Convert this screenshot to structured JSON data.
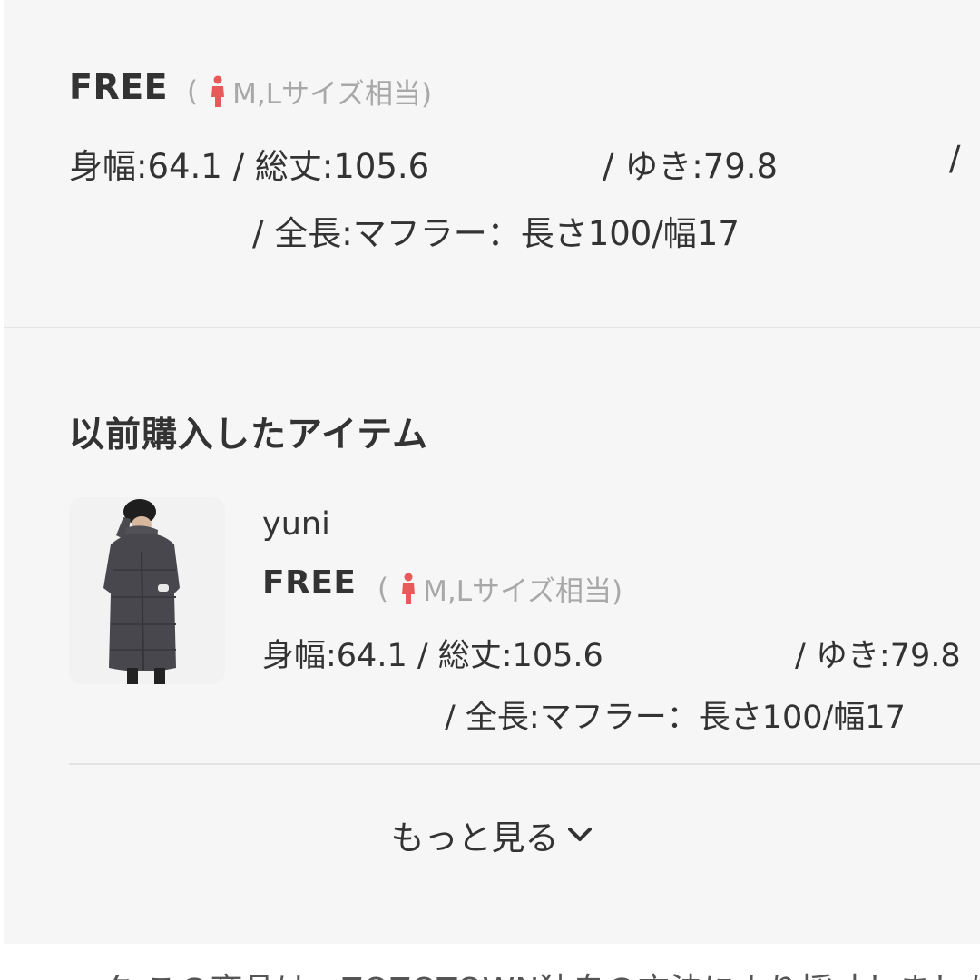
{
  "top_item": {
    "size": "FREE",
    "size_note_open": "(",
    "size_note_text": "M,Lサイズ相当)",
    "measure_a": "身幅:64.1 / 総丈:105.6",
    "measure_b": "/ ゆき:79.8",
    "measure_c": "/",
    "measure_d": "/ 全長:マフラー：長さ100/幅17"
  },
  "previous_section": {
    "title": "以前購入したアイテム",
    "item": {
      "brand": "yuni",
      "size": "FREE",
      "size_note_open": "(",
      "size_note_text": "M,Lサイズ相当)",
      "measure_a": "身幅:64.1 / 総丈:105.6",
      "measure_b": "/ ゆき:79.8",
      "measure_c": "/ 全長:マフラー：長さ100/幅17"
    }
  },
  "more": {
    "label": "もっと見る",
    "icon": "chevron-down-icon"
  },
  "bottom": {
    "partial_text": "ーク  この商品は、ZOZOTOWN独自の方法により採寸しました"
  },
  "colors": {
    "accent_icon": "#e85a5a",
    "text": "#333333",
    "muted": "#a8a8a8",
    "background": "#f6f6f6"
  }
}
